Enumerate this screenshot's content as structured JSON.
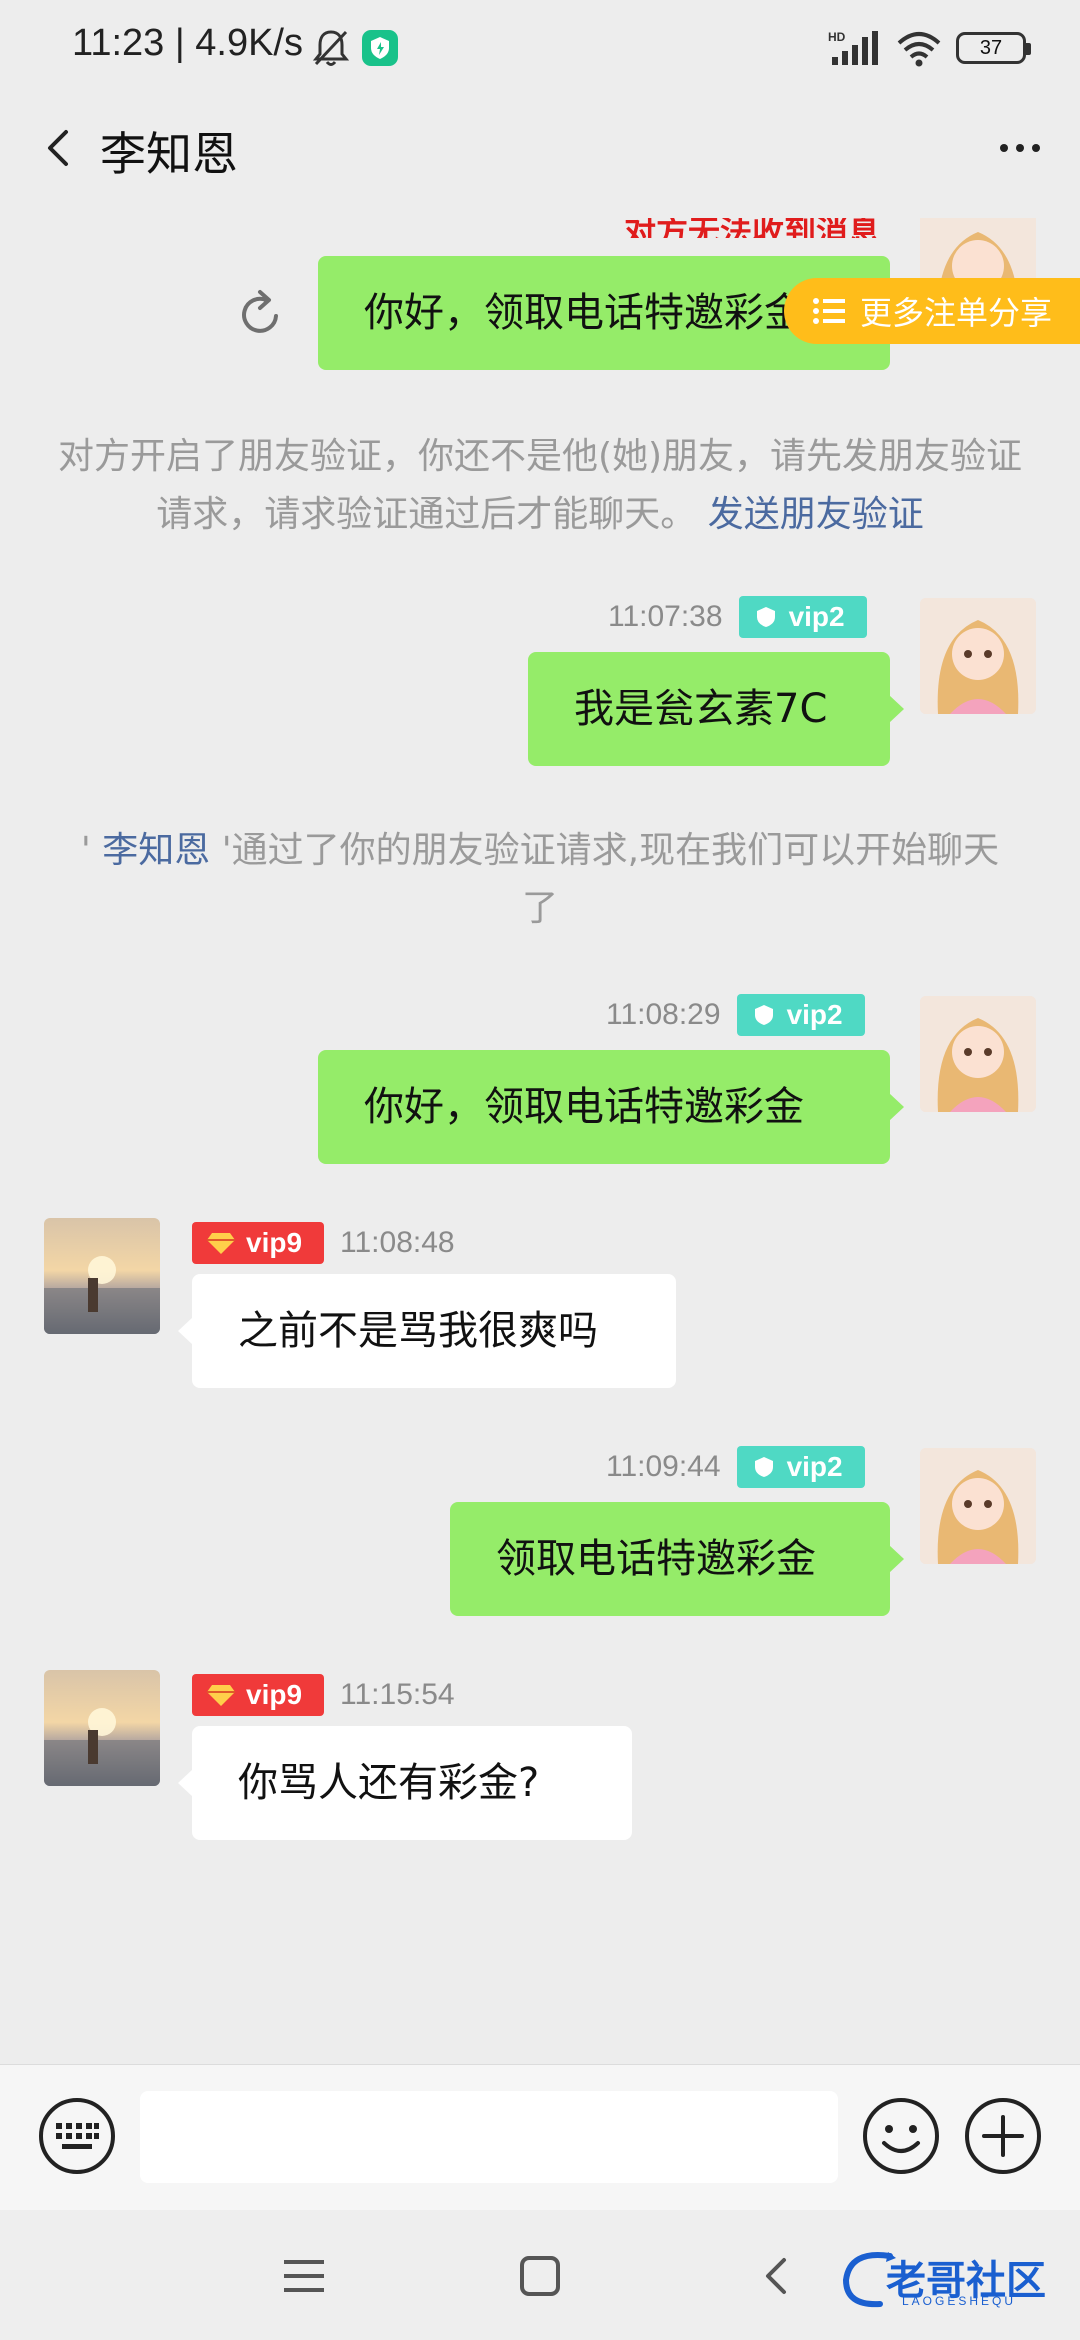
{
  "status_bar": {
    "time_speed": "11:23 | 4.9K/s",
    "network_label": "HD",
    "battery_level": "37"
  },
  "header": {
    "title": "李知恩"
  },
  "chat": {
    "partial_notice": "对方无法收到消息",
    "share_tab_label": "更多注单分享",
    "messages": [
      {
        "side": "self",
        "text": "你好，领取电话特邀彩金"
      },
      {
        "side": "self",
        "time": "11:07:38",
        "vip": "vip2",
        "text": "我是瓮玄素7C"
      },
      {
        "side": "self",
        "time": "11:08:29",
        "vip": "vip2",
        "text": "你好，领取电话特邀彩金"
      },
      {
        "side": "other",
        "time": "11:08:48",
        "vip": "vip9",
        "text": "之前不是骂我很爽吗"
      },
      {
        "side": "self",
        "time": "11:09:44",
        "vip": "vip2",
        "text": "领取电话特邀彩金"
      },
      {
        "side": "other",
        "time": "11:15:54",
        "vip": "vip9",
        "text": "你骂人还有彩金?"
      }
    ],
    "system1": {
      "text": "对方开启了朋友验证，你还不是他(她)朋友，请先发朋友验证请求，请求验证通过后才能聊天。",
      "link": "发送朋友验证"
    },
    "system2": {
      "prefix": "' ",
      "name": "李知恩",
      "text": " '通过了你的朋友验证请求,现在我们可以开始聊天了"
    }
  },
  "input": {
    "placeholder": ""
  },
  "watermark": {
    "title": "老哥社区",
    "subtitle": "LAOGESHEQU"
  },
  "colors": {
    "self_bubble": "#95ec69",
    "vip2_badge": "#4fd9c4",
    "vip9_badge": "#f03a3a",
    "share_tab": "#ffbd1a",
    "link": "#4b6aa0"
  }
}
